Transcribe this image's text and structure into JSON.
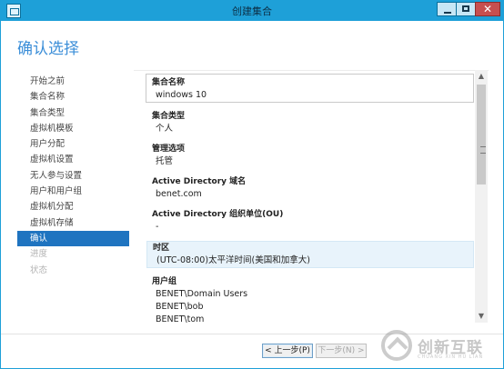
{
  "window": {
    "title": "创建集合",
    "icon": "app-window-icon",
    "controls": {
      "minimize": "minimize-icon",
      "maximize": "maximize-icon",
      "close": "close-icon",
      "close_glyph": "✕"
    }
  },
  "page": {
    "title": "确认选择"
  },
  "nav": {
    "items": [
      {
        "label": "开始之前",
        "state": "normal"
      },
      {
        "label": "集合名称",
        "state": "normal"
      },
      {
        "label": "集合类型",
        "state": "normal"
      },
      {
        "label": "虚拟机模板",
        "state": "normal"
      },
      {
        "label": "用户分配",
        "state": "normal"
      },
      {
        "label": "虚拟机设置",
        "state": "normal"
      },
      {
        "label": "无人参与设置",
        "state": "normal"
      },
      {
        "label": "用户和用户组",
        "state": "normal"
      },
      {
        "label": "虚拟机分配",
        "state": "normal"
      },
      {
        "label": "虚拟机存储",
        "state": "normal"
      },
      {
        "label": "确认",
        "state": "active"
      },
      {
        "label": "进度",
        "state": "disabled"
      },
      {
        "label": "状态",
        "state": "disabled"
      }
    ]
  },
  "summary": {
    "sections": [
      {
        "title": "集合名称",
        "values": [
          "windows 10"
        ]
      },
      {
        "title": "集合类型",
        "values": [
          "个人"
        ]
      },
      {
        "title": "管理选项",
        "values": [
          "托管"
        ]
      },
      {
        "title": "Active Directory 域名",
        "values": [
          "benet.com"
        ]
      },
      {
        "title": "Active Directory 组织单位(OU)",
        "values": [
          "-"
        ]
      },
      {
        "title": "时区",
        "values": [
          "(UTC-08:00)太平洋时间(美国和加拿大)"
        ]
      },
      {
        "title": "用户组",
        "values": [
          "BENET\\Domain Users",
          "BENET\\bob",
          "BENET\\tom"
        ]
      }
    ]
  },
  "buttons": {
    "prev": "< 上一步(P)",
    "next": "下一步(N) >"
  },
  "watermark": {
    "brand": "创新互联",
    "sub": "CHUANG XIN HU LIAN"
  }
}
